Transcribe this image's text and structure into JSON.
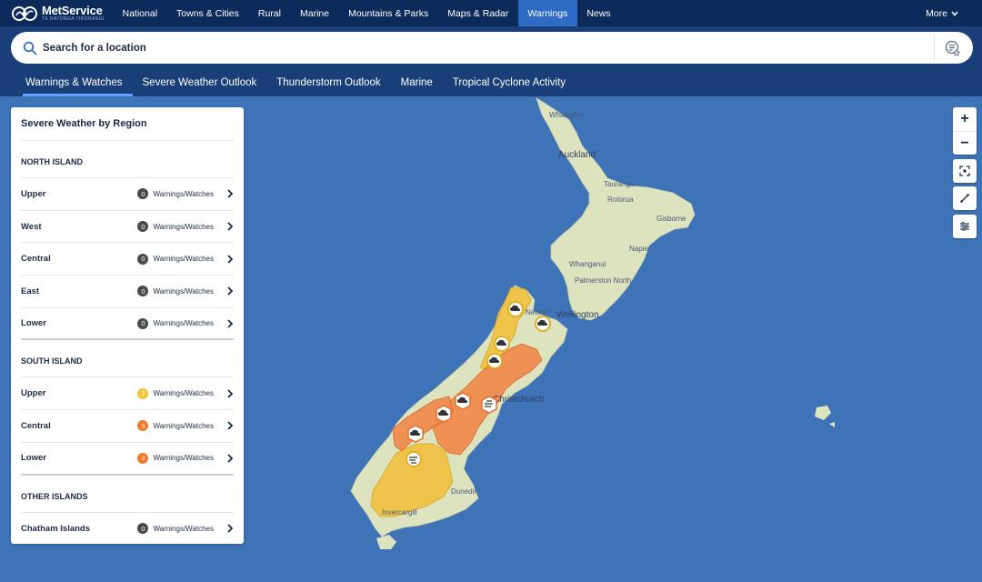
{
  "brand": {
    "name": "MetService",
    "tagline": "TE RATONGA TIRORANGI"
  },
  "nav": {
    "items": [
      {
        "label": "National"
      },
      {
        "label": "Towns & Cities"
      },
      {
        "label": "Rural"
      },
      {
        "label": "Marine"
      },
      {
        "label": "Mountains & Parks"
      },
      {
        "label": "Maps & Radar"
      },
      {
        "label": "Warnings"
      },
      {
        "label": "News"
      }
    ],
    "active": "Warnings",
    "more_label": "More"
  },
  "search": {
    "placeholder": "Search for a location"
  },
  "subtabs": [
    {
      "label": "Warnings & Watches"
    },
    {
      "label": "Severe Weather Outlook"
    },
    {
      "label": "Thunderstorm Outlook"
    },
    {
      "label": "Marine"
    },
    {
      "label": "Tropical Cyclone Activity"
    }
  ],
  "panel": {
    "title": "Severe Weather by Region",
    "badge_suffix": "Warnings/Watches",
    "sections": [
      {
        "heading": "NORTH ISLAND",
        "regions": [
          {
            "name": "Upper",
            "count": "0",
            "level": "none"
          },
          {
            "name": "West",
            "count": "0",
            "level": "none"
          },
          {
            "name": "Central",
            "count": "0",
            "level": "none"
          },
          {
            "name": "East",
            "count": "0",
            "level": "none"
          },
          {
            "name": "Lower",
            "count": "0",
            "level": "none"
          }
        ]
      },
      {
        "heading": "SOUTH ISLAND",
        "regions": [
          {
            "name": "Upper",
            "count": "3",
            "level": "watch"
          },
          {
            "name": "Central",
            "count": "3",
            "level": "warning"
          },
          {
            "name": "Lower",
            "count": "2",
            "level": "warning"
          }
        ]
      },
      {
        "heading": "OTHER ISLANDS",
        "regions": [
          {
            "name": "Chatham Islands",
            "count": "0",
            "level": "none"
          }
        ]
      }
    ]
  },
  "map": {
    "places": {
      "whangarei": "Whangārei",
      "auckland": "Auckland",
      "tauranga": "Tauranga",
      "rotorua": "Rotorua",
      "gisborne": "Gisborne",
      "napier": "Napier",
      "whanganui": "Whanganui",
      "palmerston_north": "Palmerston North",
      "wellington": "Wellington",
      "nelson": "Nelson",
      "christchurch": "Christchurch",
      "dunedin": "Dunedin",
      "invercargill": "Invercargill"
    },
    "colors": {
      "sea": "#3e73b7",
      "land": "#dde3bf",
      "watch": "#f0c03e",
      "warning": "#f08a4b",
      "badge_none": "#4a4a4a",
      "badge_watch": "#f2c230",
      "badge_warning": "#f07a28"
    }
  },
  "controls": {
    "zoom_in": "+",
    "zoom_out": "−"
  }
}
